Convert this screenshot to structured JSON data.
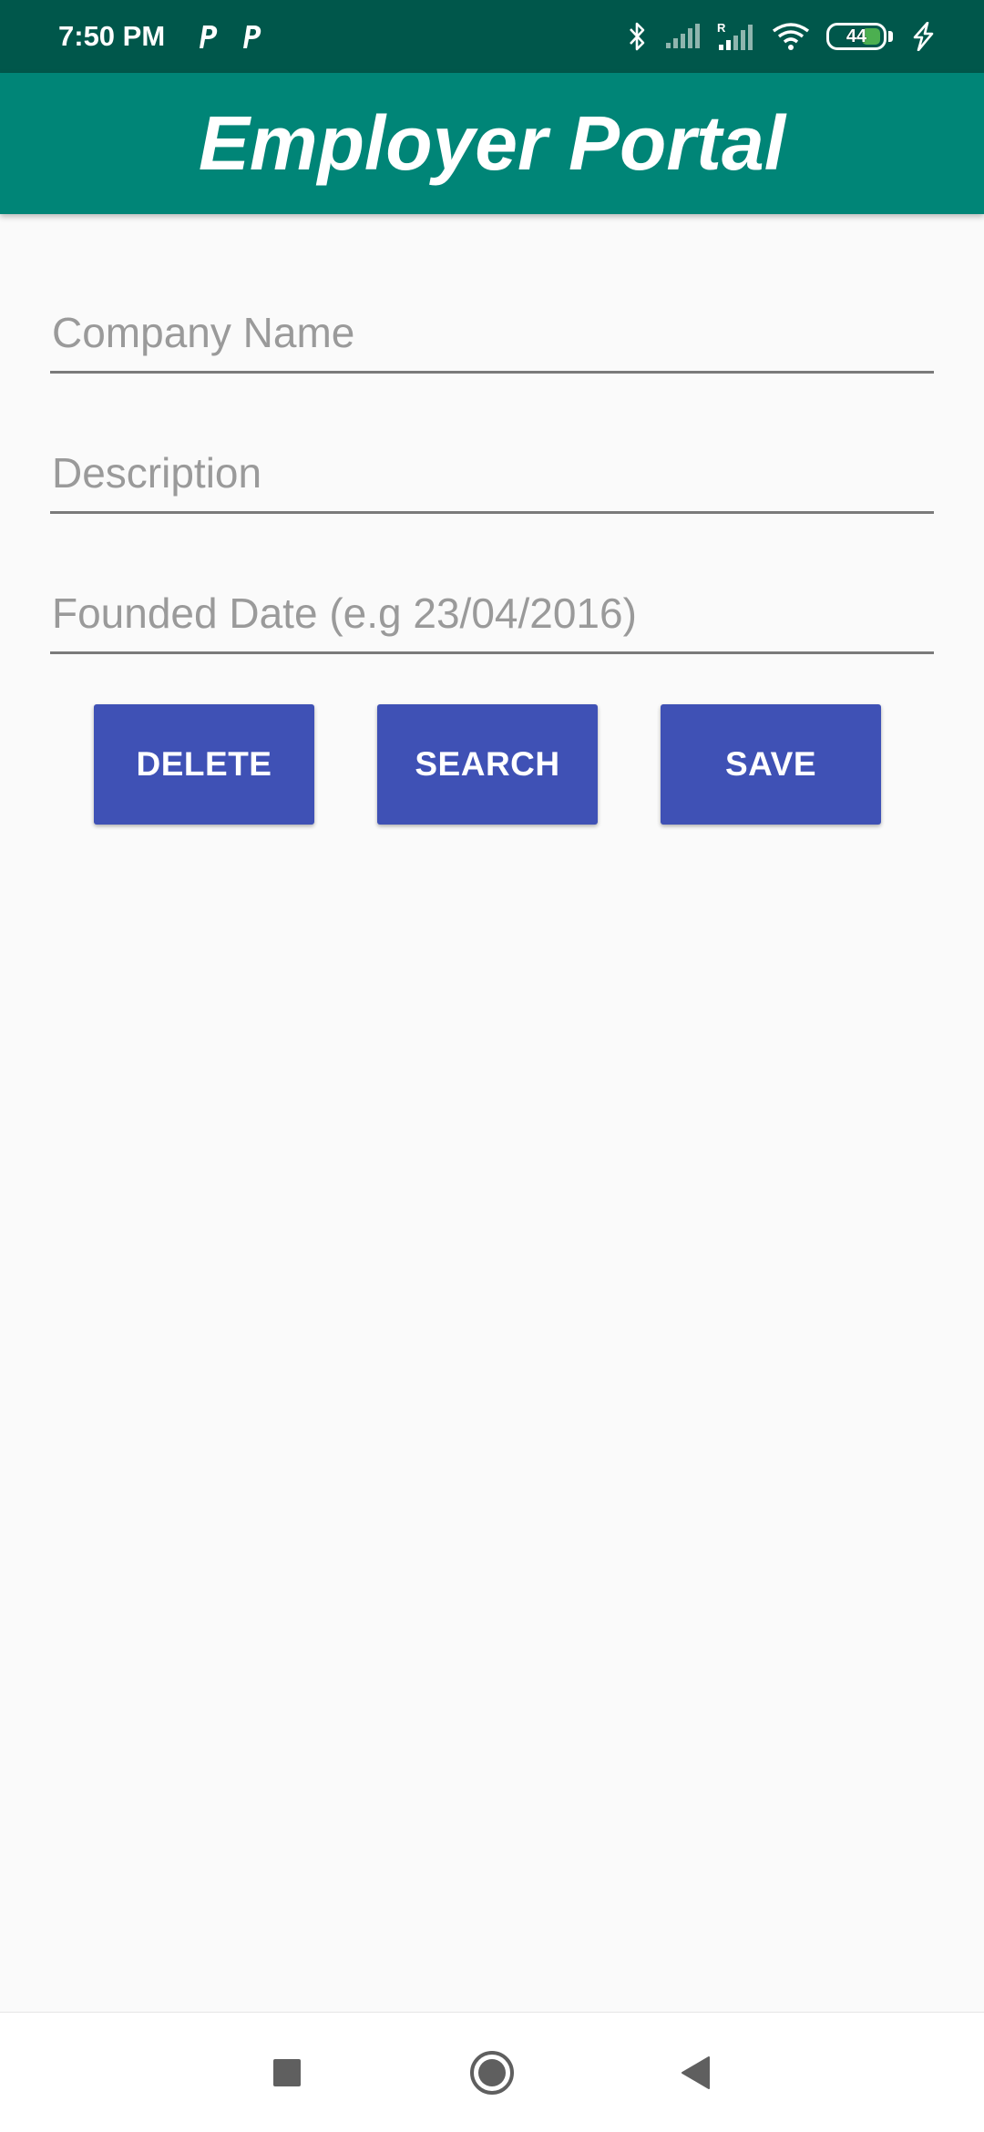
{
  "status_bar": {
    "time": "7:50 PM",
    "notification_icons": [
      "parking-p-icon",
      "parking-p-icon"
    ],
    "system_icons": [
      "bluetooth-icon",
      "signal-icon",
      "roaming-signal-icon",
      "wifi-icon",
      "battery-icon",
      "charging-icon"
    ],
    "battery_level": "44",
    "battery_color": "#4caf50"
  },
  "app_bar": {
    "title": "Employer Portal",
    "color": "#008577"
  },
  "form": {
    "company_name_placeholder": "Company Name",
    "company_name_value": "",
    "description_placeholder": "Description",
    "description_value": "",
    "founded_date_placeholder": "Founded Date (e.g 23/04/2016)",
    "founded_date_value": ""
  },
  "actions": {
    "delete_label": "DELETE",
    "search_label": "SEARCH",
    "save_label": "SAVE",
    "button_color": "#3f51b5"
  },
  "nav_bar": {
    "icons": [
      "recents-square-icon",
      "home-circle-icon",
      "back-triangle-icon"
    ]
  }
}
